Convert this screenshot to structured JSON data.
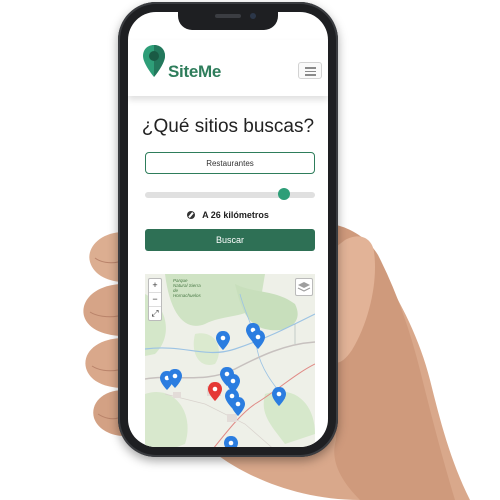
{
  "header": {
    "brand": "SiteMe",
    "menu_icon": "hamburger-icon",
    "brand_color": "#2e7d5b"
  },
  "search": {
    "title": "¿Qué sitios buscas?",
    "category_value": "Restaurantes",
    "radius_fraction": 0.82,
    "distance_label": "A 26 kilómetros",
    "button_label": "Buscar",
    "button_color": "#2e7055"
  },
  "map": {
    "zoom_in": "+",
    "zoom_out": "−",
    "fullscreen": "⤢",
    "place_label": "Parque Natural Sierra de Hornachuelos",
    "pin_color": "#2b7de0",
    "selected_pin_color": "#e53935"
  }
}
